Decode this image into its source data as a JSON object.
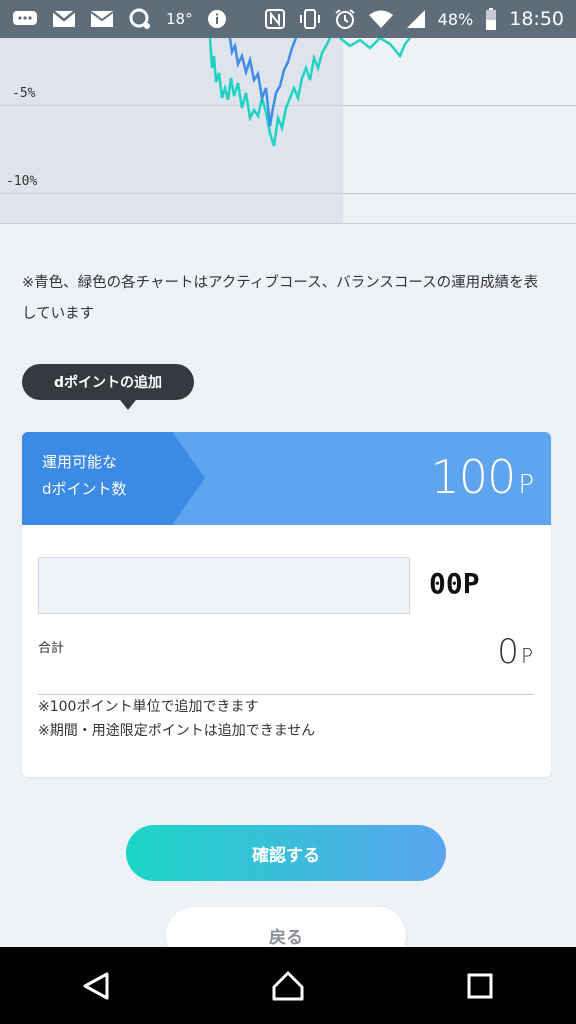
{
  "status_bar": {
    "temperature": "18°",
    "battery_percent": "48%",
    "time": "18:50",
    "icons_left": [
      "chat-bubble-icon",
      "gmail-icon",
      "mail-icon",
      "assistant-icon",
      "info-icon"
    ],
    "icons_right": [
      "nfc-icon",
      "vibrate-icon",
      "alarm-icon",
      "wifi-icon",
      "signal-icon",
      "battery-icon"
    ]
  },
  "chart": {
    "y_tick_labels": [
      "-5%",
      "-10%"
    ],
    "series_colors": {
      "active": "#3d8ee8",
      "balance": "#1fd3c3"
    }
  },
  "chart_note": "※青色、緑色の各チャートはアクティブコース、バランスコースの運用成績を表しています",
  "add_points": {
    "tooltip_label": "dポイントの追加",
    "header": {
      "label_line1": "運用可能な",
      "label_line2": "dポイント数",
      "value": "100",
      "unit": "P"
    },
    "input": {
      "value": "",
      "placeholder": "",
      "suffix": "00P"
    },
    "total": {
      "label": "合計",
      "value": "0",
      "unit": "P"
    },
    "notes": [
      "※100ポイント単位で追加できます",
      "※期間・用途限定ポイントは追加できません"
    ]
  },
  "buttons": {
    "confirm_label": "確認する",
    "back_label": "戻る"
  },
  "colors": {
    "header_blue": "#5ea4ef",
    "header_chevron": "#3b8ae6",
    "tooltip_bg": "#353a40",
    "confirm_gradient_start": "#1cd6c6",
    "confirm_gradient_end": "#5aa5ef"
  },
  "nav_bar": {
    "icons": [
      "back-triangle-icon",
      "home-icon",
      "recents-icon"
    ]
  }
}
